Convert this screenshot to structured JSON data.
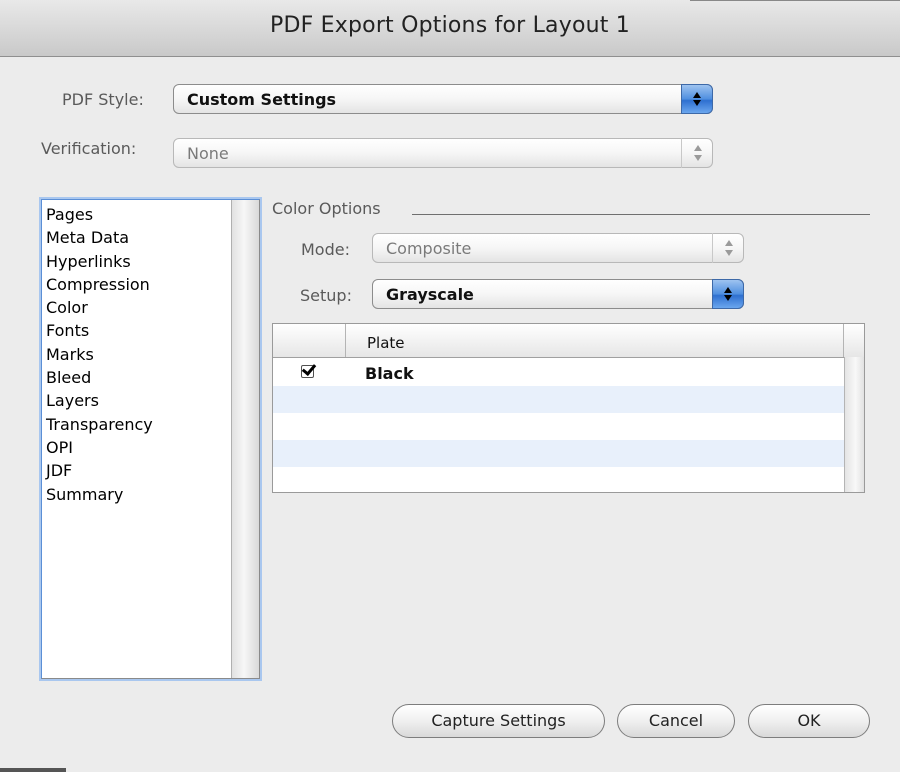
{
  "window": {
    "title": "PDF Export Options for Layout 1"
  },
  "pdf_style": {
    "label": "PDF Style:",
    "value": "Custom Settings"
  },
  "verification": {
    "label": "Verification:",
    "value": "None"
  },
  "sidebar": {
    "items": [
      "Pages",
      "Meta Data",
      "Hyperlinks",
      "Compression",
      "Color",
      "Fonts",
      "Marks",
      "Bleed",
      "Layers",
      "Transparency",
      "OPI",
      "JDF",
      "Summary"
    ]
  },
  "color_options": {
    "group_label": "Color Options",
    "mode": {
      "label": "Mode:",
      "value": "Composite"
    },
    "setup": {
      "label": "Setup:",
      "value": "Grayscale"
    },
    "plates_table": {
      "header": "Plate",
      "rows": [
        {
          "checked": true,
          "name": "Black"
        }
      ]
    }
  },
  "buttons": {
    "capture": "Capture Settings",
    "cancel": "Cancel",
    "ok": "OK"
  },
  "colors": {
    "accent": "#4f8fe0",
    "selection_row": "#e8f0fb",
    "background": "#ececec"
  }
}
